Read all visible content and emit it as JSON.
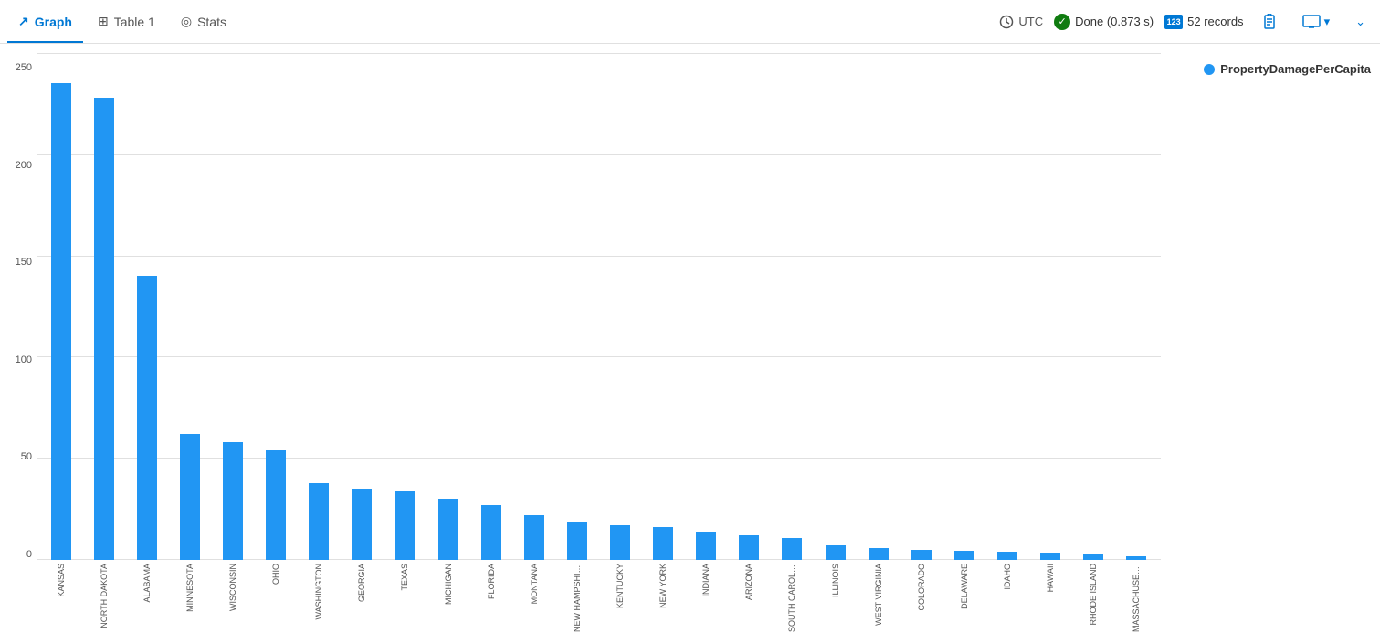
{
  "tabs": [
    {
      "id": "graph",
      "label": "Graph",
      "icon": "📈",
      "active": true
    },
    {
      "id": "table1",
      "label": "Table 1",
      "icon": "⊞",
      "active": false
    },
    {
      "id": "stats",
      "label": "Stats",
      "icon": "◎",
      "active": false
    }
  ],
  "toolbar": {
    "timezone": "UTC",
    "status": "Done (0.873 s)",
    "records": "52 records",
    "clipboard_icon": "📋",
    "expand_icon": "⊟"
  },
  "chart": {
    "legend_label": "PropertyDamagePerCapita",
    "y_axis": [
      250,
      200,
      150,
      100,
      50,
      0
    ],
    "max_value": 250,
    "bars": [
      {
        "label": "KANSAS",
        "value": 235
      },
      {
        "label": "NORTH DAKOTA",
        "value": 228
      },
      {
        "label": "ALABAMA",
        "value": 140
      },
      {
        "label": "MINNESOTA",
        "value": 62
      },
      {
        "label": "WISCONSIN",
        "value": 58
      },
      {
        "label": "OHIO",
        "value": 54
      },
      {
        "label": "WASHINGTON",
        "value": 38
      },
      {
        "label": "GEORGIA",
        "value": 35
      },
      {
        "label": "TEXAS",
        "value": 34
      },
      {
        "label": "MICHIGAN",
        "value": 30
      },
      {
        "label": "FLORIDA",
        "value": 27
      },
      {
        "label": "MONTANA",
        "value": 22
      },
      {
        "label": "NEW HAMPSHIRE",
        "value": 19
      },
      {
        "label": "KENTUCKY",
        "value": 17
      },
      {
        "label": "NEW YORK",
        "value": 16
      },
      {
        "label": "INDIANA",
        "value": 14
      },
      {
        "label": "ARIZONA",
        "value": 12
      },
      {
        "label": "SOUTH CAROLINA",
        "value": 11
      },
      {
        "label": "ILLINOIS",
        "value": 7
      },
      {
        "label": "WEST VIRGINIA",
        "value": 6
      },
      {
        "label": "COLORADO",
        "value": 5
      },
      {
        "label": "DELAWARE",
        "value": 4.5
      },
      {
        "label": "IDAHO",
        "value": 4
      },
      {
        "label": "HAWAII",
        "value": 3.5
      },
      {
        "label": "RHODE ISLAND",
        "value": 3
      },
      {
        "label": "MASSACHUSETTS",
        "value": 2
      }
    ]
  }
}
